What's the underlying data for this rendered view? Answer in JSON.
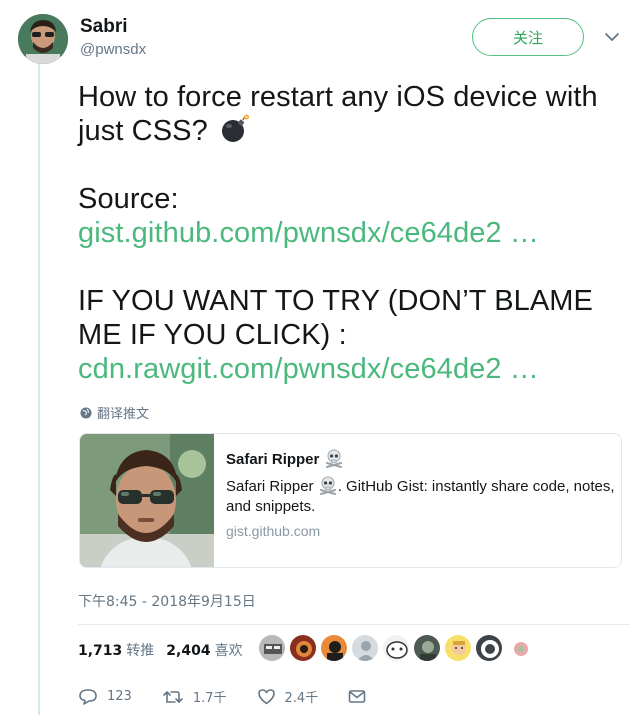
{
  "user": {
    "name": "Sabri",
    "handle": "@pwnsdx",
    "follow_label": "关注"
  },
  "tweet": {
    "line1": "How to force restart any iOS device with just CSS?",
    "source_label": "Source:",
    "source_link": "gist.github.com/pwnsdx/ce64de2 …",
    "warning": "IF YOU WANT TO TRY (DON’T BLAME ME IF YOU CLICK) :",
    "try_link": "cdn.rawgit.com/pwnsdx/ce64de2  …",
    "emoji_icon": "bomb-icon"
  },
  "translate_label": "翻译推文",
  "card": {
    "title": "Safari Ripper",
    "desc_prefix": "Safari Ripper",
    "desc_suffix": ". GitHub Gist: instantly share code, notes, and snippets.",
    "domain": "gist.github.com",
    "title_icon": "skull-crossbones-icon"
  },
  "timestamp": "下午8:45 - 2018年9月15日",
  "stats": {
    "retweets_count": "1,713",
    "retweets_label": "转推",
    "likes_count": "2,404",
    "likes_label": "喜欢"
  },
  "actions": {
    "replies": "123",
    "retweets": "1.7千",
    "likes": "2.4千"
  },
  "colors": {
    "accent_green": "#4bb87d",
    "thread_line": "#d2ecd8",
    "muted": "#657786"
  }
}
